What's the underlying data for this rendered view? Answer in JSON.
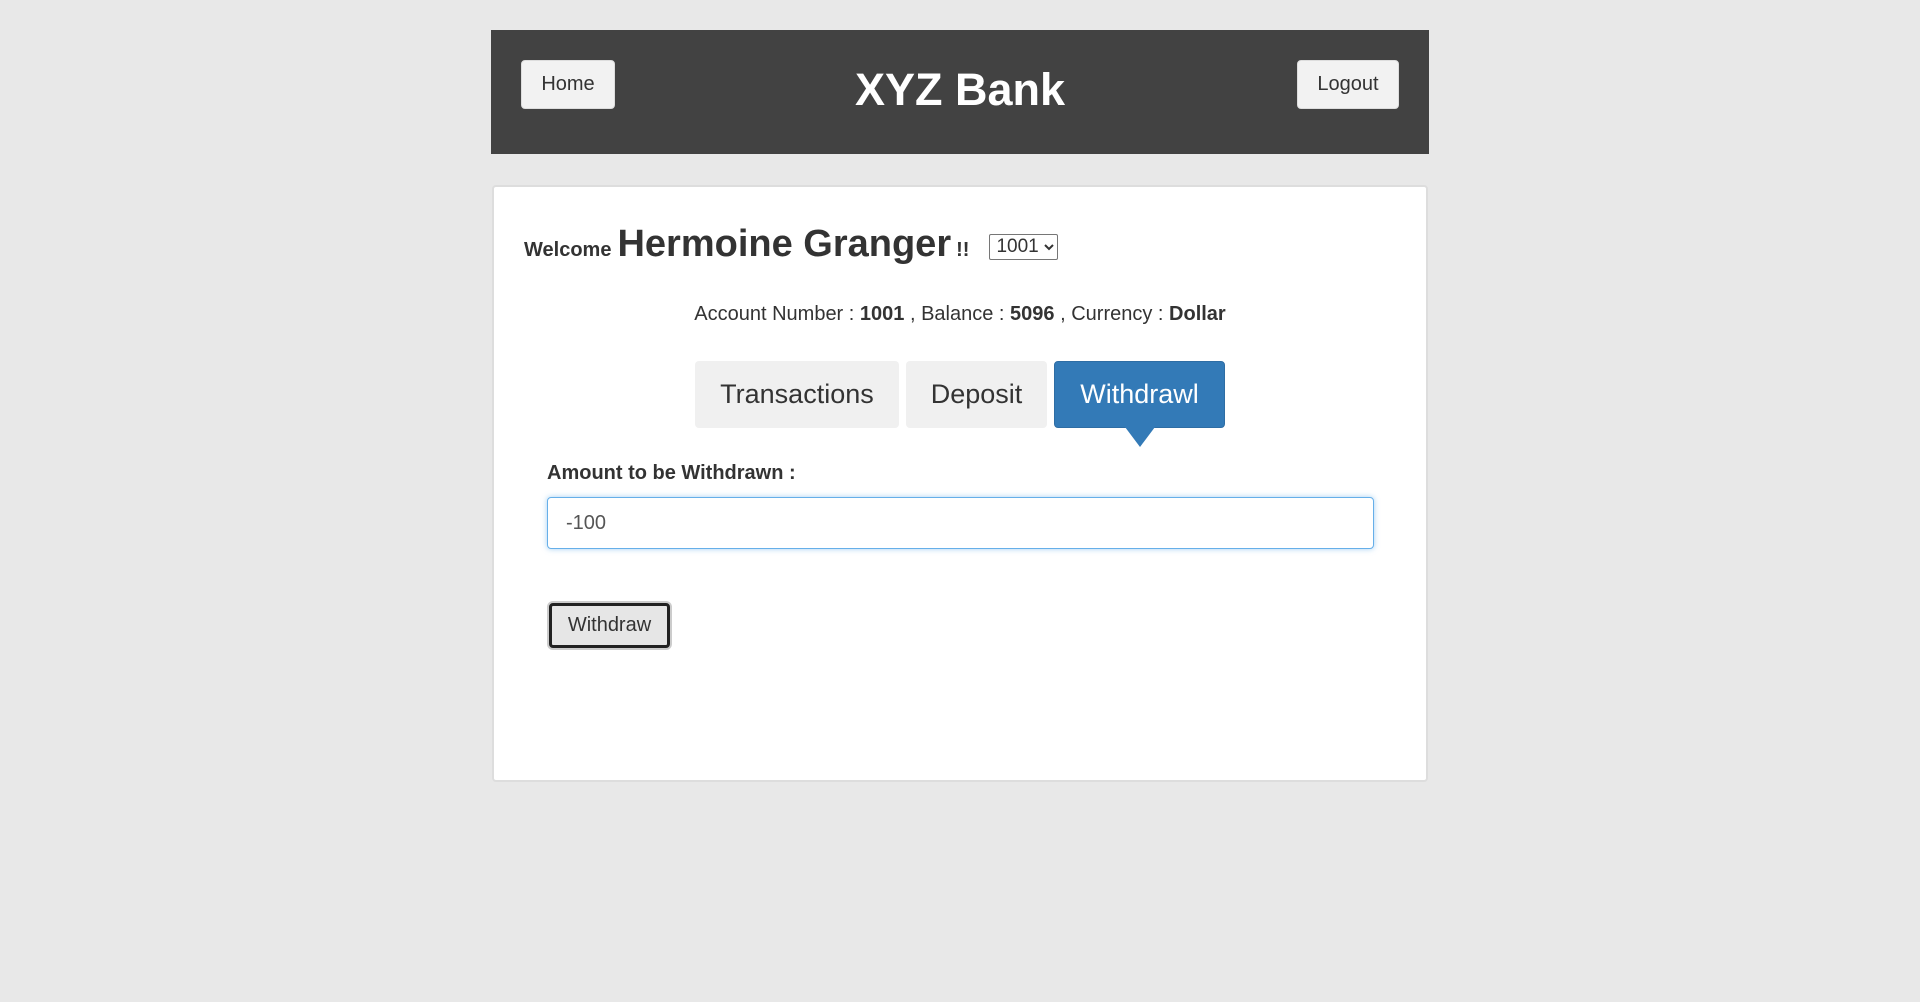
{
  "header": {
    "home_label": "Home",
    "bank_title": "XYZ Bank",
    "logout_label": "Logout"
  },
  "welcome": {
    "prefix": "Welcome",
    "customer_name": "Hermoine Granger",
    "suffix": "!!",
    "selected_account": "1001"
  },
  "account_info": {
    "number_label": "Account Number :",
    "number_value": "1001",
    "balance_label": ", Balance :",
    "balance_value": "5096",
    "currency_label": ", Currency :",
    "currency_value": "Dollar"
  },
  "tabs": [
    {
      "label": "Transactions",
      "active": false
    },
    {
      "label": "Deposit",
      "active": false
    },
    {
      "label": "Withdrawl",
      "active": true
    }
  ],
  "withdraw_form": {
    "amount_label": "Amount to be Withdrawn :",
    "amount_value": "-100",
    "submit_label": "Withdraw"
  },
  "colors": {
    "header_bg": "#424242",
    "active_tab": "#337ab7",
    "page_bg": "#e8e8e8"
  }
}
